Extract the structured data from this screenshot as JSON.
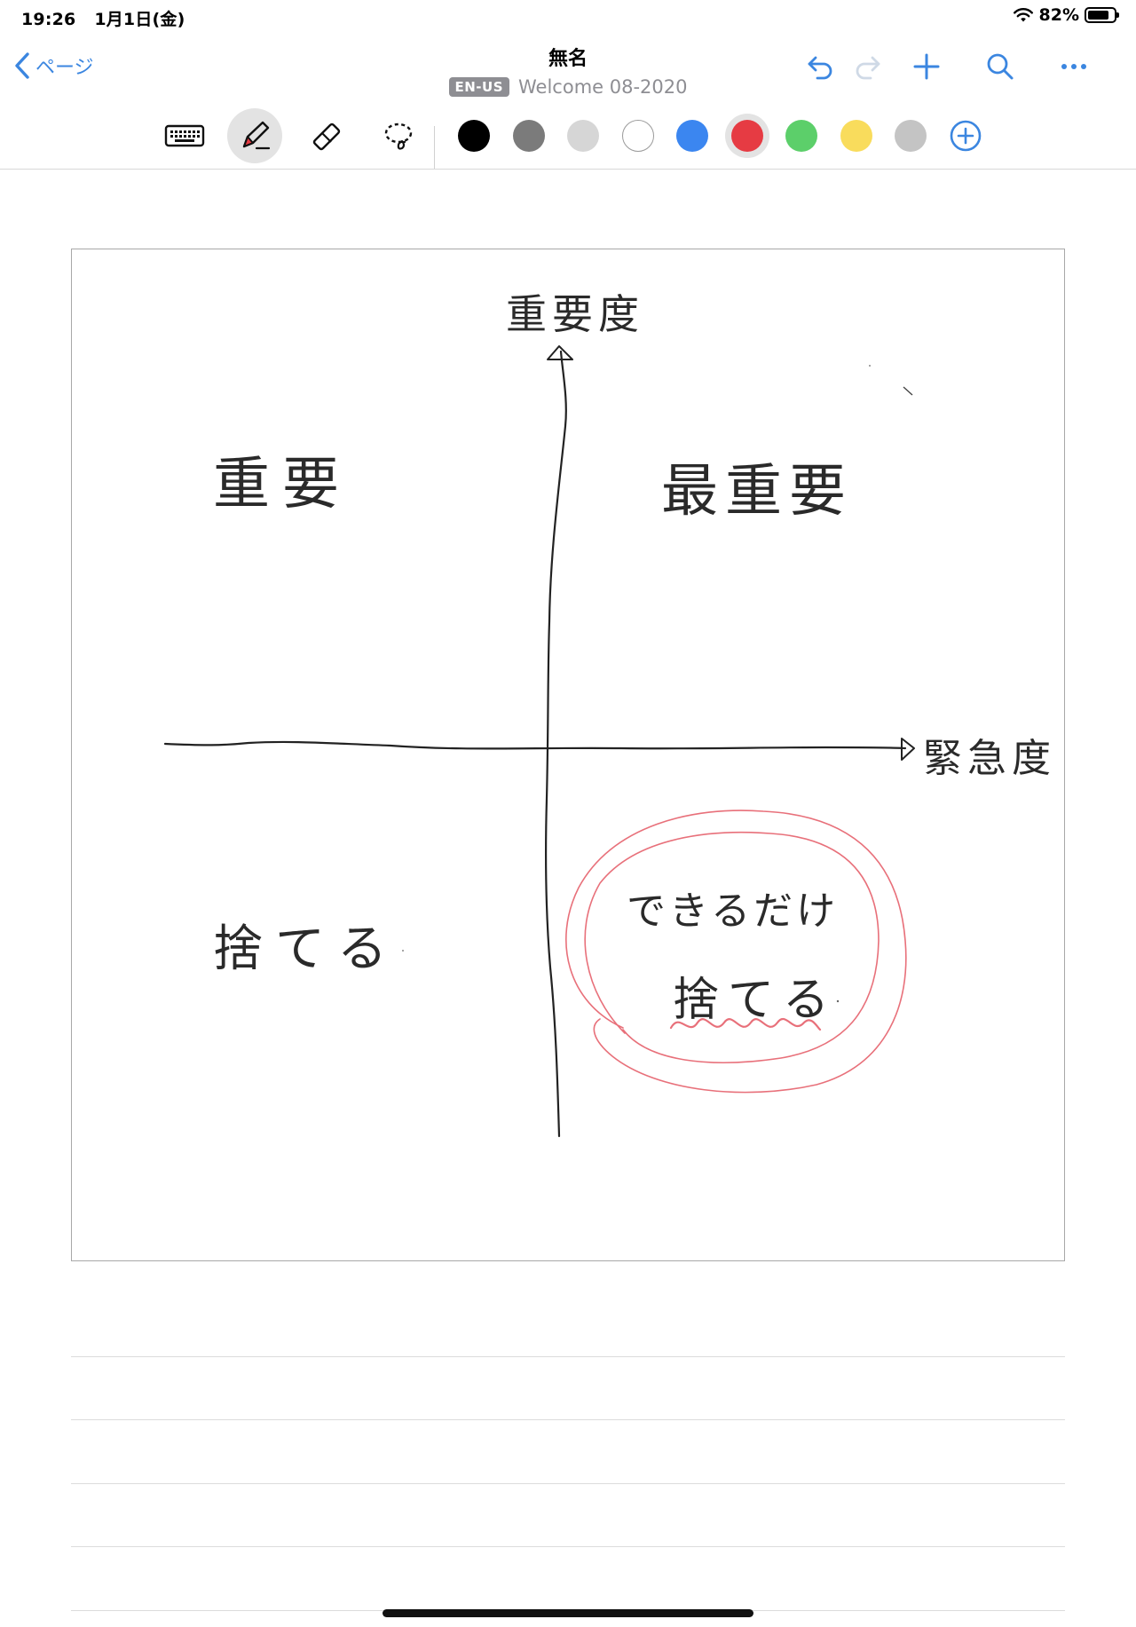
{
  "status_bar": {
    "time": "19:26",
    "date": "1月1日(金)",
    "battery_percent": "82%",
    "battery_level": 0.82
  },
  "nav": {
    "back_label": "ページ",
    "title": "無名",
    "language_badge": "EN-US",
    "notebook_name": "Welcome 08-2020",
    "actions": [
      "undo-icon",
      "redo-icon",
      "plus-icon",
      "search-icon",
      "more-icon"
    ]
  },
  "toolbar": {
    "tools": [
      "keyboard-icon",
      "pen-icon",
      "eraser-icon",
      "lasso-icon"
    ],
    "active_tool": "pen-icon",
    "colors": [
      "#000000",
      "#7b7b7b",
      "#d6d6d6",
      "#ffffff",
      "#3b86f0",
      "#e63b43",
      "#5ccf6a",
      "#f9dc5c",
      "#c4c4c4"
    ],
    "active_color": "#e63b43",
    "accent": "#3b86e0"
  },
  "canvas": {
    "axis_y_label": "重要度",
    "axis_x_label": "緊急度",
    "quadrant_top_left": "重要",
    "quadrant_top_right": "最重要",
    "quadrant_bottom_left": "捨てる",
    "quadrant_bottom_right_line1": "できるだけ",
    "quadrant_bottom_right_line2": "捨てる",
    "highlight_color": "#e8707a"
  }
}
